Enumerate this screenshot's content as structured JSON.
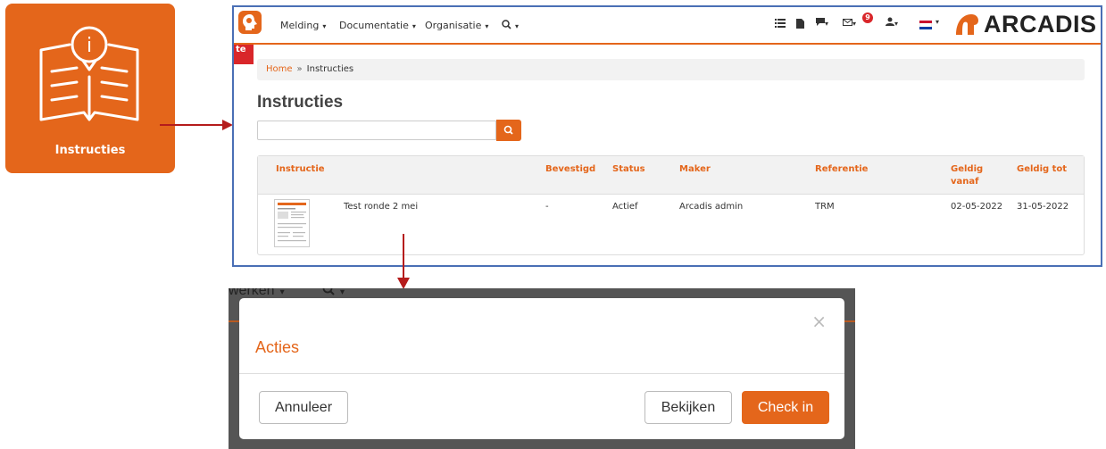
{
  "tile": {
    "label": "Instructies"
  },
  "nav": {
    "items": [
      {
        "label": "Melding",
        "caret": "▾"
      },
      {
        "label": "Documentatie",
        "caret": "▾"
      },
      {
        "label": "Organisatie",
        "caret": "▾"
      }
    ],
    "search_caret": "▾",
    "notification_count": "9",
    "brand": "ARCADIS"
  },
  "env_tab": "te",
  "breadcrumb": {
    "home": "Home",
    "separator": "»",
    "current": "Instructies"
  },
  "page_title": "Instructies",
  "search": {
    "placeholder": ""
  },
  "table": {
    "headers": {
      "instructie": "Instructie",
      "bevestigd": "Bevestigd",
      "status": "Status",
      "maker": "Maker",
      "referentie": "Referentie",
      "geldig_vanaf_1": "Geldig",
      "geldig_vanaf_2": "vanaf",
      "geldig_tot": "Geldig tot"
    },
    "rows": [
      {
        "name": "Test ronde 2 mei",
        "bevestigd": "-",
        "status": "Actief",
        "maker": "Arcadis admin",
        "referentie": "TRM",
        "vanaf": "02-05-2022",
        "tot": "31-05-2022"
      }
    ]
  },
  "modal": {
    "behind_text": "werken",
    "behind_caret": "▾",
    "behind_search_caret": "▾",
    "close": "×",
    "title": "Acties",
    "buttons": {
      "cancel": "Annuleer",
      "view": "Bekijken",
      "checkin": "Check in"
    }
  },
  "colors": {
    "accent": "#e4661b",
    "arrow": "#b51c1c",
    "frame": "#4a6fb5"
  }
}
